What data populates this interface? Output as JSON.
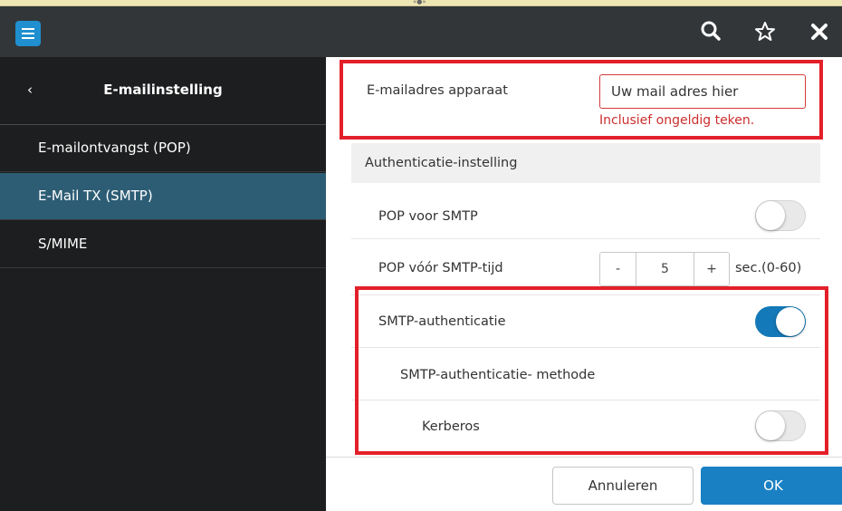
{
  "header": {
    "menu_icon": "hamburger-menu-icon",
    "search_icon": "search-icon",
    "favorite_icon": "star-icon",
    "close_icon": "close-icon",
    "accent_color": "#1f8fcf"
  },
  "sidebar": {
    "back_glyph": "‹",
    "title": "E-mailinstelling",
    "items": [
      {
        "label": "E-mailontvangst (POP)",
        "active": false
      },
      {
        "label": "E-Mail TX (SMTP)",
        "active": true
      },
      {
        "label": "S/MIME",
        "active": false
      }
    ]
  },
  "main": {
    "email_device": {
      "label": "E-mailadres apparaat",
      "value": "Uw mail adres hier",
      "error": "Inclusief ongeldig teken."
    },
    "auth_section": {
      "title": "Authenticatie-instelling"
    },
    "pop_before_smtp": {
      "label": "POP voor SMTP",
      "on": false
    },
    "pop_before_smtp_time": {
      "label": "POP vóór SMTP-tijd",
      "minus": "-",
      "value": "5",
      "plus": "+",
      "range": "sec.(0-60)"
    },
    "smtp_auth": {
      "label": "SMTP-authenticatie",
      "on": true
    },
    "smtp_auth_method": {
      "label": "SMTP-authenticatie- methode"
    },
    "kerberos": {
      "label": "Kerberos",
      "on": false
    }
  },
  "footer": {
    "cancel_label": "Annuleren",
    "ok_label": "OK"
  },
  "colors": {
    "header_bg": "#333639",
    "sidebar_bg": "#1d1e1f",
    "sidebar_active": "#2d5d75",
    "toggle_on": "#1479b8",
    "ok_button": "#1a80c4",
    "error": "#cc2e2e",
    "highlight": "#e3202a"
  }
}
